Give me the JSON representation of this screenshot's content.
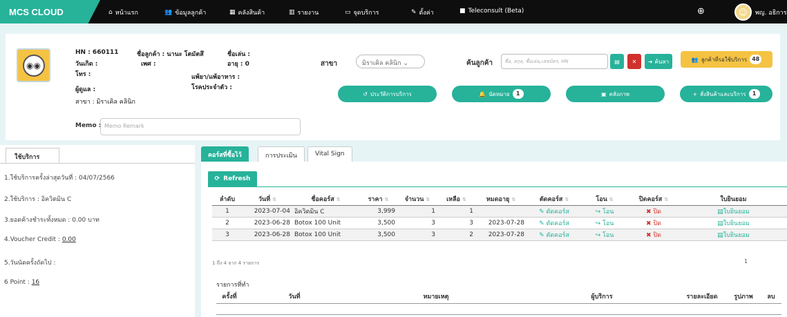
{
  "nav": {
    "brand": "MCS CLOUD",
    "items": [
      {
        "icon": "home-icon",
        "glyph": "🏠",
        "label": "หน้าแรก"
      },
      {
        "icon": "users-icon",
        "glyph": "👥",
        "label": "ข้อมูลลูกค้า"
      },
      {
        "icon": "box-icon",
        "glyph": "▦",
        "label": "คลังสินค้า"
      },
      {
        "icon": "chart-icon",
        "glyph": "📊",
        "label": "รายงาน"
      },
      {
        "icon": "monitor-icon",
        "glyph": "🖵",
        "label": "จุดบริการ"
      },
      {
        "icon": "wrench-icon",
        "glyph": "🔧",
        "label": "ตั้งค่า"
      },
      {
        "icon": "video-icon",
        "glyph": "▶",
        "label": "Teleconsult (Beta)"
      }
    ],
    "user_name": "พญ. อธิการ"
  },
  "patient": {
    "hn": "HN : 660111",
    "name": "ชื่อลูกค้า : นานะ โตมัตสึ",
    "nickname": "ชื่อเล่น :",
    "birthday": "วันเกิด :",
    "sex": "เพศ :",
    "age": "อายุ : 0",
    "phone": "โทร :",
    "allergy": "แพ้ยา/แพ้อาหาร :",
    "caretaker": "ผู้ดูแล :",
    "disease": "โรคประจำตัว :",
    "branch": "สาขา : มิราเคิล คลินิก",
    "memo_label": "Memo :",
    "memo_placeholder": "Memo Remark"
  },
  "search": {
    "branch_label": "สาขา",
    "branch_value": "มิราเคิล คลินิก",
    "label": "ค้นลูกค้า",
    "placeholder": "ชื่อ, สกุล, ชื่อเล่น,เลขบัตร, HN",
    "go_label": "ค้นหา"
  },
  "actions": {
    "queue_label": "ลูกค้าที่รอใช้บริการ",
    "queue_count": "48",
    "history_label": "ประวัติการบริการ",
    "appointment_label": "นัดหมาย",
    "appointment_count": "1",
    "gallery_label": "คลังภาพ",
    "order_label": "สั่งสินค้าและบริการ",
    "order_count": "1"
  },
  "left": {
    "tab": "ใช้บริการ",
    "items": [
      "1.ใช้บริการครั้งล่าสุดวันที่ : 04/07/2566",
      "2.ใช้บริการ : อิควิตมิน C",
      "3.ยอดค้างชำระทั้งหมด : 0.00 บาท"
    ],
    "voucher_label": "4.Voucher Credit : ",
    "voucher_value": "0.00",
    "next_appt": "5.วันนัดครั้งถัดไป :",
    "point_label": "6 Point : ",
    "point_value": "16"
  },
  "tabs": [
    "คอร์สที่ซื้อไว้",
    "การประเมิน",
    "Vital Sign"
  ],
  "courses": {
    "refresh_label": "Refresh",
    "headers": [
      "ลำดับ",
      "วันที่",
      "ชื่อคอร์ส",
      "ราคา",
      "จำนวน",
      "เหลือ",
      "หมดอายุ",
      "ตัดคอร์ส",
      "โอน",
      "ปิดคอร์ส",
      "ใบยินยอม"
    ],
    "rows": [
      {
        "no": "1",
        "date": "2023-07-04",
        "name": "อิควิตมิน C",
        "price": "3,999",
        "qty": "1",
        "left": "1",
        "exp": ""
      },
      {
        "no": "2",
        "date": "2023-06-28",
        "name": "Botox 100 Unit",
        "price": "3,500",
        "qty": "3",
        "left": "3",
        "exp": "2023-07-28"
      },
      {
        "no": "3",
        "date": "2023-06-28",
        "name": "Botox 100 Unit",
        "price": "3,500",
        "qty": "3",
        "left": "2",
        "exp": "2023-07-28"
      }
    ],
    "cut_label": "ตัดคอร์ส",
    "transfer_label": "โอน",
    "close_label": "ปิด",
    "consent_label": "ใบยินยอม",
    "info": "1 ถึง 4 จาก 4 รายการ",
    "page": "1"
  },
  "treatment": {
    "title": "รายการที่ทำ",
    "headers": [
      "ครั้งที่",
      "วันที่",
      "หมายเหตุ",
      "ผู้บริการ",
      "รายละเอียด",
      "รูปภาพ",
      "ลบ"
    ]
  },
  "colors": {
    "accent": "#27b29a",
    "nav": "#0e0e0e",
    "warning": "#f5c343",
    "danger": "#d0312d"
  }
}
